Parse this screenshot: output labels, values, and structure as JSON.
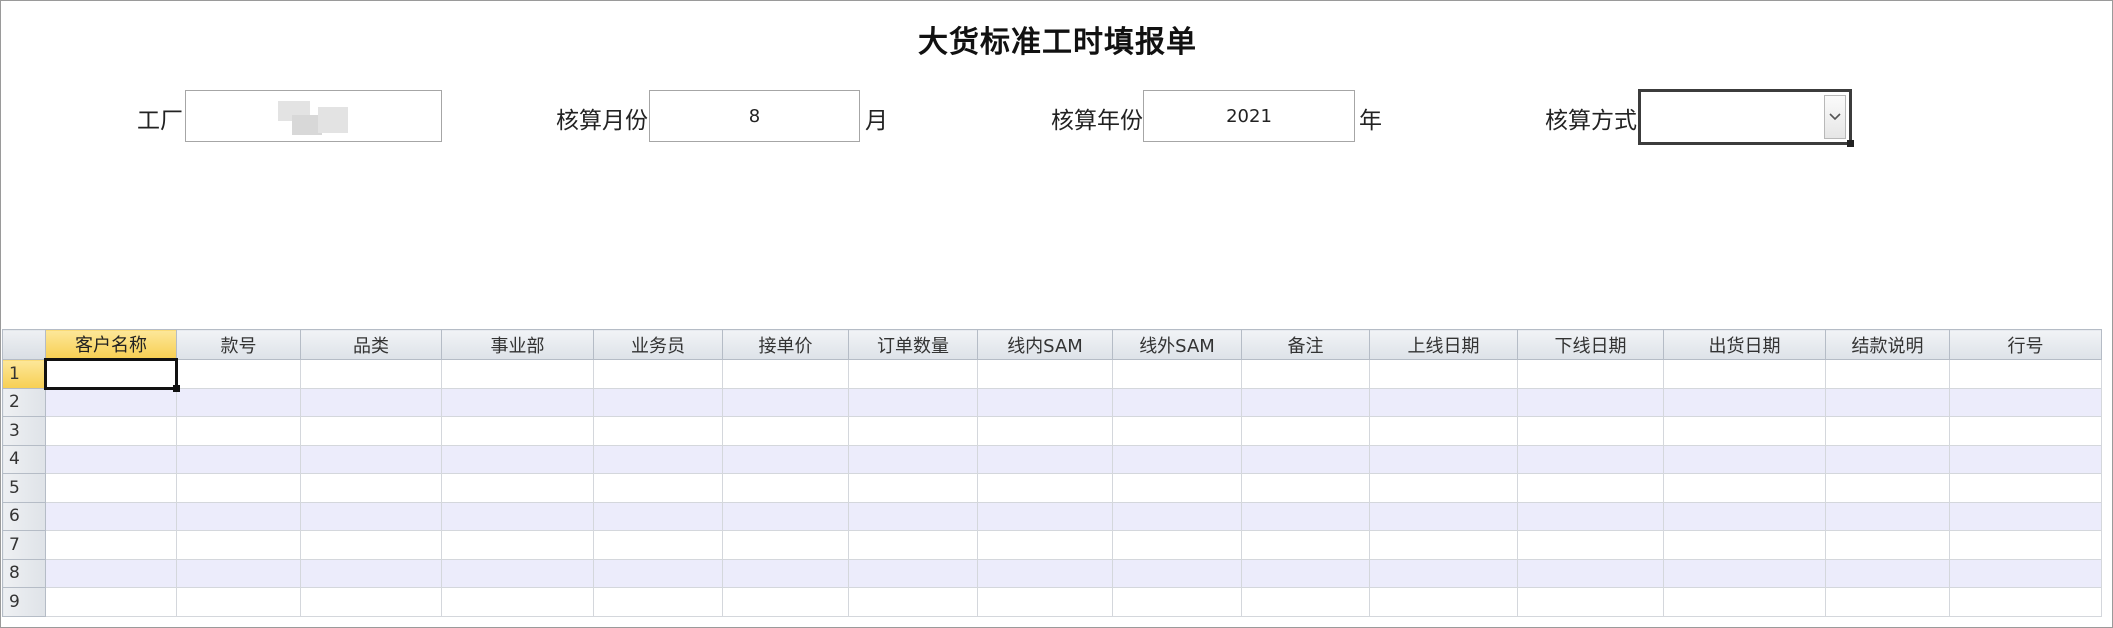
{
  "form": {
    "title": "大货标准工时填报单",
    "factory_label": "工厂",
    "factory_value": "",
    "month_label": "核算月份",
    "month_value": "8",
    "month_unit": "月",
    "year_label": "核算年份",
    "year_value": "2021",
    "year_unit": "年",
    "method_label": "核算方式",
    "method_value": ""
  },
  "grid": {
    "columns": [
      "客户名称",
      "款号",
      "品类",
      "事业部",
      "业务员",
      "接单价",
      "订单数量",
      "线内SAM",
      "线外SAM",
      "备注",
      "上线日期",
      "下线日期",
      "出货日期",
      "结款说明",
      "行号"
    ],
    "rows": [
      "1",
      "2",
      "3",
      "4",
      "5",
      "6",
      "7",
      "8",
      "9"
    ],
    "selected_column": "客户名称",
    "selected_row": "1"
  },
  "icons": {
    "dropdown": "chevron-down-icon"
  },
  "colors": {
    "header_selected": "#f7cf53",
    "alt_row": "#ececfb"
  }
}
